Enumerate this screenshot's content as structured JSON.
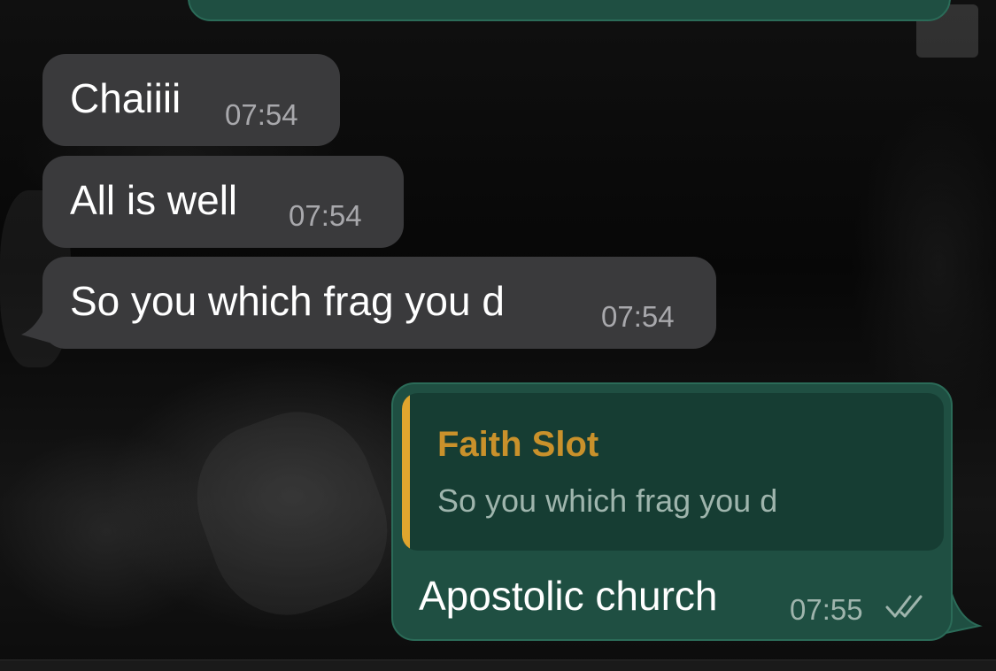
{
  "messages": {
    "incoming": [
      {
        "text": "Chaiiii",
        "time": "07:54"
      },
      {
        "text": "All is well",
        "time": "07:54"
      },
      {
        "text": "So you which frag you d",
        "time": "07:54"
      }
    ],
    "outgoing_reply": {
      "quoted_sender": "Faith Slot",
      "quoted_text": "So you which frag you d",
      "text": "Apostolic church",
      "time": "07:55",
      "status_icon": "double-check-icon"
    }
  },
  "colors": {
    "incoming_bubble": "#3a3a3c",
    "outgoing_bubble": "#1f4f42",
    "quote_accent": "#e0a52e",
    "quote_name": "#c9912b"
  }
}
